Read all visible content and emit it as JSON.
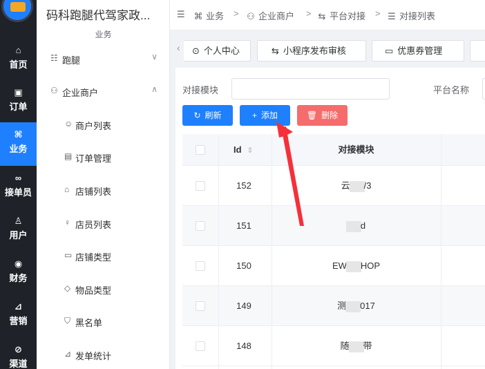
{
  "rail": {
    "items": [
      {
        "label": "首页",
        "icon": "home-icon",
        "glyph": "⌂"
      },
      {
        "label": "订单",
        "icon": "order-icon",
        "glyph": "▣"
      },
      {
        "label": "业务",
        "icon": "business-icon",
        "glyph": "⌘"
      },
      {
        "label": "接单员",
        "icon": "bike-icon",
        "glyph": "∞"
      },
      {
        "label": "用户",
        "icon": "user-icon",
        "glyph": "♙"
      },
      {
        "label": "财务",
        "icon": "finance-icon",
        "glyph": "◉"
      },
      {
        "label": "营销",
        "icon": "marketing-icon",
        "glyph": "⊿"
      },
      {
        "label": "渠道",
        "icon": "channel-icon",
        "glyph": "⊘"
      }
    ],
    "active_index": 2,
    "accent": "#1e80ff"
  },
  "sidebar": {
    "app_title": "码科跑腿代驾家政...",
    "group": "业务",
    "items": [
      {
        "label": "跑腿",
        "icon": "errand-icon",
        "glyph": "☷",
        "chevron": "∨"
      },
      {
        "label": "企业商户",
        "icon": "merchant-icon",
        "glyph": "⚇",
        "chevron": "∧"
      },
      {
        "label": "商户列表",
        "icon": "merchant-list-icon",
        "glyph": "☺"
      },
      {
        "label": "订单管理",
        "icon": "order-manage-icon",
        "glyph": "▤"
      },
      {
        "label": "店铺列表",
        "icon": "shop-icon",
        "glyph": "⌂"
      },
      {
        "label": "店员列表",
        "icon": "clerk-icon",
        "glyph": "♀"
      },
      {
        "label": "店铺类型",
        "icon": "shop-type-icon",
        "glyph": "▭"
      },
      {
        "label": "物品类型",
        "icon": "tag-icon",
        "glyph": "◇"
      },
      {
        "label": "黑名单",
        "icon": "shield-icon",
        "glyph": "⛉"
      },
      {
        "label": "发单统计",
        "icon": "chart-icon",
        "glyph": "⊿"
      }
    ]
  },
  "breadcrumb": {
    "toggle_glyph": "☰",
    "items": [
      {
        "label": "业务",
        "glyph": "⌘"
      },
      {
        "label": "企业商户",
        "glyph": "⚇"
      },
      {
        "label": "平台对接",
        "glyph": "⇆"
      },
      {
        "label": "对接列表",
        "glyph": "☰"
      }
    ],
    "separator": ">"
  },
  "tabs": {
    "nav_prev": "‹",
    "items": [
      {
        "label": "个人中心",
        "glyph": "⊙"
      },
      {
        "label": "小程序发布审核",
        "glyph": "⇆"
      },
      {
        "label": "优惠券管理",
        "glyph": "▭"
      }
    ]
  },
  "search": {
    "fields": [
      {
        "label": "对接模块",
        "value": ""
      },
      {
        "label": "平台名称",
        "value": ""
      }
    ]
  },
  "toolbar": {
    "refresh": "刷新",
    "add": "添加",
    "delete": "删除",
    "refresh_glyph": "↻",
    "add_glyph": "+",
    "delete_glyph": "🗑"
  },
  "table": {
    "columns": [
      "Id",
      "对接模块"
    ],
    "sort_glyph": "⇕",
    "rows": [
      {
        "id": "152",
        "a": "云",
        "b": "/3"
      },
      {
        "id": "151",
        "a": "",
        "b": "d"
      },
      {
        "id": "150",
        "a": "EW",
        "b": "HOP"
      },
      {
        "id": "149",
        "a": "测",
        "b": "017"
      },
      {
        "id": "148",
        "a": "随",
        "b": "带"
      }
    ]
  },
  "annotation_color": "#f5303a"
}
